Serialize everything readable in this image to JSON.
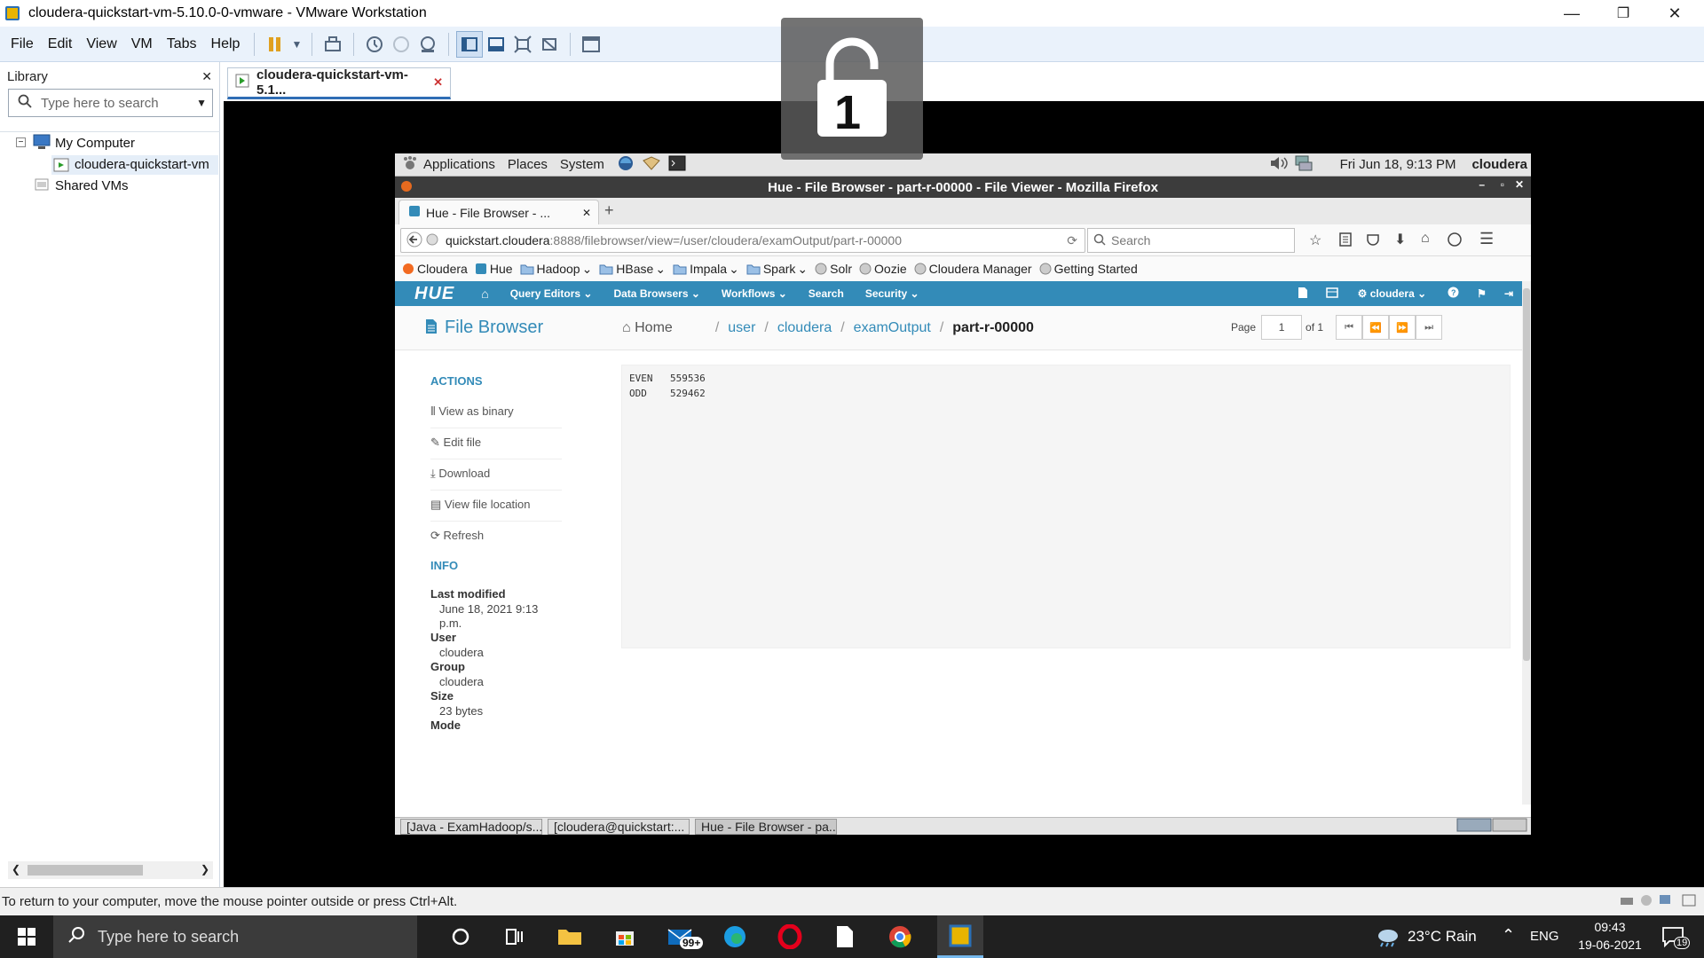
{
  "window": {
    "title": "cloudera-quickstart-vm-5.10.0-0-vmware - VMware Workstation",
    "min": "—",
    "max": "❐",
    "close": "✕"
  },
  "menu": [
    "File",
    "Edit",
    "View",
    "VM",
    "Tabs",
    "Help"
  ],
  "library": {
    "title": "Library",
    "close": "✕",
    "search_placeholder": "Type here to search",
    "tree": {
      "my_computer": "My Computer",
      "vm": "cloudera-quickstart-vm",
      "shared": "Shared VMs"
    },
    "expander": "−"
  },
  "vm_tab": {
    "label": "cloudera-quickstart-vm-5.1...",
    "close": "✕"
  },
  "lock_overlay": {
    "number": "1"
  },
  "guest_panel": {
    "applications": "Applications",
    "places": "Places",
    "system": "System",
    "datetime": "Fri Jun 18,  9:13 PM",
    "user": "cloudera"
  },
  "firefox": {
    "title": "Hue - File Browser - part-r-00000 - File Viewer - Mozilla Firefox",
    "tab_label": "Hue - File Browser - ...",
    "tab_close": "✕",
    "new_tab": "+",
    "url_host": "quickstart.cloudera",
    "url_path": ":8888/filebrowser/view=/user/cloudera/examOutput/part-r-00000",
    "search_placeholder": "Search",
    "bookmarks": [
      "Cloudera",
      "Hue",
      "Hadoop",
      "HBase",
      "Impala",
      "Spark",
      "Solr",
      "Oozie",
      "Cloudera Manager",
      "Getting Started"
    ]
  },
  "hue": {
    "logo": "HUE",
    "nav": [
      "Query Editors",
      "Data Browsers",
      "Workflows",
      "Search",
      "Security"
    ],
    "user": "cloudera",
    "page_title": "File Browser",
    "actions_title": "ACTIONS",
    "actions": [
      "View as binary",
      "Edit file",
      "Download",
      "View file location",
      "Refresh"
    ],
    "info_title": "INFO",
    "info": {
      "last_modified_label": "Last modified",
      "last_modified_value_1": "June 18, 2021 9:13",
      "last_modified_value_2": "p.m.",
      "user_label": "User",
      "user_value": "cloudera",
      "group_label": "Group",
      "group_value": "cloudera",
      "size_label": "Size",
      "size_value": "23 bytes",
      "mode_label": "Mode"
    },
    "breadcrumb": {
      "home": "Home",
      "user": "user",
      "cloudera": "cloudera",
      "examOutput": "examOutput",
      "current": "part-r-00000",
      "sep": "/"
    },
    "pager": {
      "page_label": "Page",
      "page_value": "1",
      "of_label": "of 1"
    },
    "file_rows": [
      {
        "key": "EVEN",
        "value": "559536"
      },
      {
        "key": "ODD",
        "value": "529462"
      }
    ]
  },
  "guest_taskbar": [
    "[Java - ExamHadoop/s...",
    "[cloudera@quickstart:...",
    "Hue - File Browser - pa..."
  ],
  "vm_status": "To return to your computer, move the mouse pointer outside or press Ctrl+Alt.",
  "win_taskbar": {
    "search_placeholder": "Type here to search",
    "mail_badge": "99+",
    "weather": "23°C  Rain",
    "lang": "ENG",
    "time": "09:43",
    "date": "19-06-2021",
    "notif_count": "19"
  },
  "colors": {
    "hue_blue": "#338bb8",
    "vm_menubar": "#eaf2fb",
    "taskbar": "#202020"
  }
}
